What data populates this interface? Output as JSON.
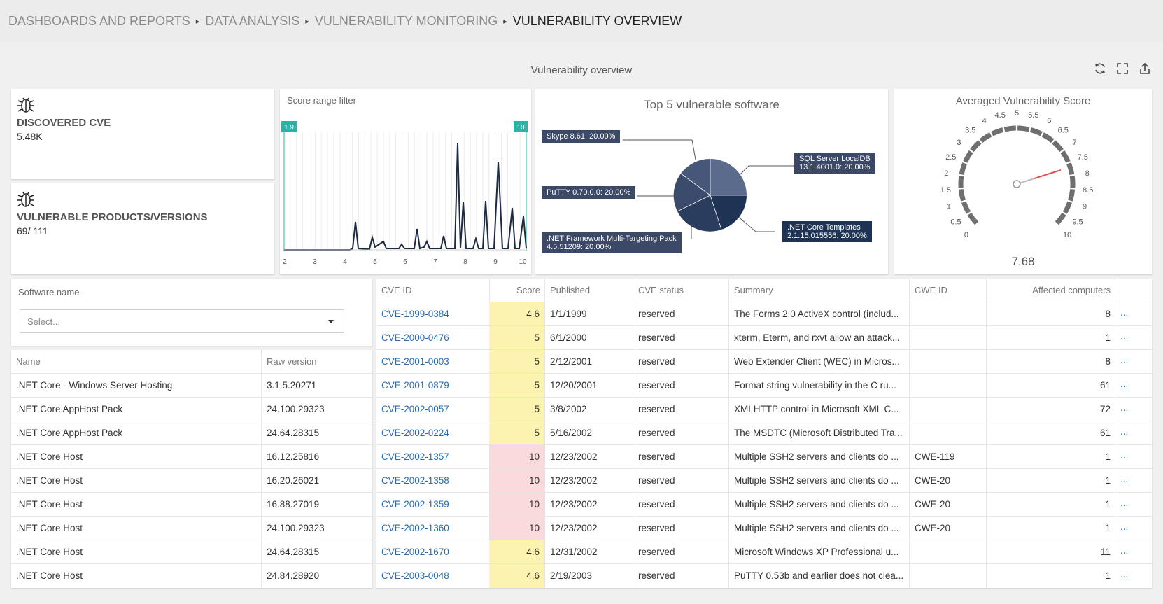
{
  "breadcrumb": [
    "DASHBOARDS AND REPORTS",
    "DATA ANALYSIS",
    "VULNERABILITY MONITORING",
    "VULNERABILITY OVERVIEW"
  ],
  "breadcrumb_sep": "▸",
  "dashboard_title": "Vulnerability overview",
  "kpis": [
    {
      "label": "DISCOVERED CVE",
      "value": "5.48K",
      "icon": "bug-icon"
    },
    {
      "label": "VULNERABLE PRODUCTS/VERSIONS",
      "value": "69/ 111",
      "icon": "bug-icon"
    }
  ],
  "score_filter": {
    "title": "Score range filter",
    "range_min_label": "1.9",
    "range_max_label": "10",
    "accent": "#2bb3a6",
    "x_ticks": [
      "2",
      "3",
      "4",
      "5",
      "6",
      "7",
      "8",
      "9",
      "10"
    ],
    "line_color": "#1c2a44"
  },
  "top5": {
    "title": "Top 5 vulnerable software",
    "labels": [
      {
        "line1": "Skype 8.61: 20.00%",
        "line2": ""
      },
      {
        "line1": "PuTTY 0.70.0.0: 20.00%",
        "line2": ""
      },
      {
        "line1": ".NET Framework Multi-Targeting Pack",
        "line2": "4.5.51209: 20.00%"
      },
      {
        "line1": "SQL Server LocalDB",
        "line2": "13.1.4001.0: 20.00%"
      },
      {
        "line1": ".NET Core Templates",
        "line2": "2.1.15.015556: 20.00%"
      }
    ]
  },
  "gauge": {
    "title": "Averaged Vulnerability Score",
    "value": 7.68,
    "value_label": "7.68",
    "min": 0,
    "max": 10,
    "tick_labels": [
      "0",
      "0.5",
      "1",
      "1.5",
      "2",
      "2.5",
      "3",
      "3.5",
      "4",
      "4.5",
      "5",
      "5.5",
      "6",
      "6.5",
      "7",
      "7.5",
      "8",
      "8.5",
      "9",
      "9.5",
      "10"
    ],
    "needle_color": "#e05050"
  },
  "software_filter": {
    "label": "Software name",
    "placeholder": "Select..."
  },
  "software_table": {
    "columns": [
      "Name",
      "Raw version"
    ],
    "rows": [
      [
        ".NET Core - Windows Server Hosting",
        "3.1.5.20271"
      ],
      [
        ".NET Core AppHost Pack",
        "24.100.29323"
      ],
      [
        ".NET Core AppHost Pack",
        "24.64.28315"
      ],
      [
        ".NET Core Host",
        "16.12.25816"
      ],
      [
        ".NET Core Host",
        "16.20.26021"
      ],
      [
        ".NET Core Host",
        "16.88.27019"
      ],
      [
        ".NET Core Host",
        "24.100.29323"
      ],
      [
        ".NET Core Host",
        "24.64.28315"
      ],
      [
        ".NET Core Host",
        "24.84.28920"
      ]
    ]
  },
  "cve_table": {
    "columns": [
      "CVE ID",
      "Score",
      "Published",
      "CVE status",
      "Summary",
      "CWE ID",
      "Affected computers",
      ""
    ],
    "more_label": "...",
    "score_colors": {
      "medium": "#fdf3b0",
      "high": "#fadadd"
    },
    "rows": [
      {
        "id": "CVE-1999-0384",
        "score": "4.6",
        "sev": "medium",
        "published": "1/1/1999",
        "status": "reserved",
        "summary": "The Forms 2.0 ActiveX control (includ...",
        "cwe": "",
        "affected": "8"
      },
      {
        "id": "CVE-2000-0476",
        "score": "5",
        "sev": "medium",
        "published": "6/1/2000",
        "status": "reserved",
        "summary": "xterm, Eterm, and rxvt allow an attack...",
        "cwe": "",
        "affected": "1"
      },
      {
        "id": "CVE-2001-0003",
        "score": "5",
        "sev": "medium",
        "published": "2/12/2001",
        "status": "reserved",
        "summary": "Web Extender Client (WEC) in Micros...",
        "cwe": "",
        "affected": "8"
      },
      {
        "id": "CVE-2001-0879",
        "score": "5",
        "sev": "medium",
        "published": "12/20/2001",
        "status": "reserved",
        "summary": "Format string vulnerability in the C ru...",
        "cwe": "",
        "affected": "61"
      },
      {
        "id": "CVE-2002-0057",
        "score": "5",
        "sev": "medium",
        "published": "3/8/2002",
        "status": "reserved",
        "summary": "XMLHTTP control in Microsoft XML C...",
        "cwe": "",
        "affected": "72"
      },
      {
        "id": "CVE-2002-0224",
        "score": "5",
        "sev": "medium",
        "published": "5/16/2002",
        "status": "reserved",
        "summary": "The MSDTC (Microsoft Distributed Tra...",
        "cwe": "",
        "affected": "61"
      },
      {
        "id": "CVE-2002-1357",
        "score": "10",
        "sev": "high",
        "published": "12/23/2002",
        "status": "reserved",
        "summary": "Multiple SSH2 servers and clients do ...",
        "cwe": "CWE-119",
        "affected": "1"
      },
      {
        "id": "CVE-2002-1358",
        "score": "10",
        "sev": "high",
        "published": "12/23/2002",
        "status": "reserved",
        "summary": "Multiple SSH2 servers and clients do ...",
        "cwe": "CWE-20",
        "affected": "1"
      },
      {
        "id": "CVE-2002-1359",
        "score": "10",
        "sev": "high",
        "published": "12/23/2002",
        "status": "reserved",
        "summary": "Multiple SSH2 servers and clients do ...",
        "cwe": "CWE-20",
        "affected": "1"
      },
      {
        "id": "CVE-2002-1360",
        "score": "10",
        "sev": "high",
        "published": "12/23/2002",
        "status": "reserved",
        "summary": "Multiple SSH2 servers and clients do ...",
        "cwe": "CWE-20",
        "affected": "1"
      },
      {
        "id": "CVE-2002-1670",
        "score": "4.6",
        "sev": "medium",
        "published": "12/31/2002",
        "status": "reserved",
        "summary": "Microsoft Windows XP Professional u...",
        "cwe": "",
        "affected": "11"
      },
      {
        "id": "CVE-2003-0048",
        "score": "4.6",
        "sev": "medium",
        "published": "2/19/2003",
        "status": "reserved",
        "summary": "PuTTY 0.53b and earlier does not clea...",
        "cwe": "",
        "affected": "1"
      }
    ]
  }
}
